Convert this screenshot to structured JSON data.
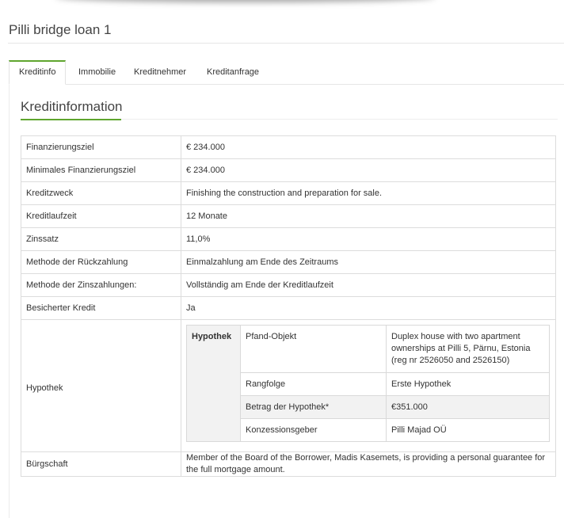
{
  "page": {
    "title": "Pilli bridge loan 1"
  },
  "tabs": [
    {
      "label": "Kreditinfo",
      "active": true
    },
    {
      "label": "Immobilie",
      "active": false
    },
    {
      "label": "Kreditnehmer",
      "active": false
    },
    {
      "label": "Kreditanfrage",
      "active": false
    }
  ],
  "section": {
    "title": "Kreditinformation"
  },
  "rows": [
    {
      "label": "Finanzierungsziel",
      "value": "€ 234.000"
    },
    {
      "label": "Minimales Finanzierungsziel",
      "value": "€ 234.000"
    },
    {
      "label": "Kreditzweck",
      "value": "Finishing the construction and preparation for sale."
    },
    {
      "label": "Kreditlaufzeit",
      "value": "12 Monate"
    },
    {
      "label": "Zinssatz",
      "value": "11,0%"
    },
    {
      "label": "Methode der Rückzahlung",
      "value": "Einmalzahlung am Ende des Zeitraums"
    },
    {
      "label": "Methode der Zinszahlungen:",
      "value": "Vollständig am Ende der Kreditlaufzeit"
    },
    {
      "label": "Besicherter Kredit",
      "value": "Ja"
    }
  ],
  "hypothek": {
    "label": "Hypothek",
    "header": "Hypothek",
    "items": [
      {
        "key": "Pfand-Objekt",
        "value": "Duplex house with two apartment ownerships at Pilli 5, Pärnu, Estonia (reg nr 2526050 and 2526150)"
      },
      {
        "key": "Rangfolge",
        "value": "Erste Hypothek"
      },
      {
        "key": "Betrag der Hypothek*",
        "value": "€351.000"
      },
      {
        "key": "Konzessionsgeber",
        "value": "Pilli Majad OÜ"
      }
    ]
  },
  "buergschaft": {
    "label": "Bürgschaft",
    "value": "Member of the Board of the Borrower, Madis Kasemets, is providing a personal guarantee for the full mortgage amount."
  },
  "colors": {
    "accent": "#5fa52e",
    "border": "#dcdcdc",
    "shade": "#f2f2f2"
  }
}
